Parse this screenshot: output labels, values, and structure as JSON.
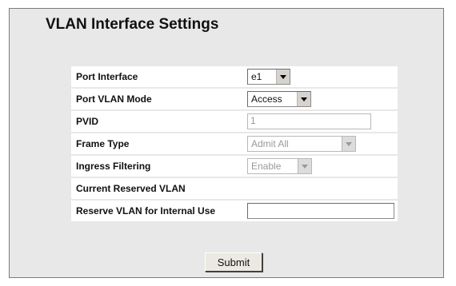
{
  "page": {
    "title": "VLAN Interface Settings"
  },
  "fields": [
    {
      "label": "Port Interface",
      "control": "select",
      "value": "e1",
      "enabled": true
    },
    {
      "label": "Port VLAN Mode",
      "control": "select",
      "value": "Access",
      "enabled": true
    },
    {
      "label": "PVID",
      "control": "text",
      "value": "1",
      "enabled": false
    },
    {
      "label": "Frame Type",
      "control": "select",
      "value": "Admit All",
      "enabled": false
    },
    {
      "label": "Ingress Filtering",
      "control": "select",
      "value": "Enable",
      "enabled": false
    },
    {
      "label": "Current Reserved VLAN",
      "control": "none",
      "value": ""
    },
    {
      "label": "Reserve VLAN for Internal Use",
      "control": "text",
      "value": "",
      "enabled": true
    }
  ],
  "actions": {
    "submit_label": "Submit"
  }
}
